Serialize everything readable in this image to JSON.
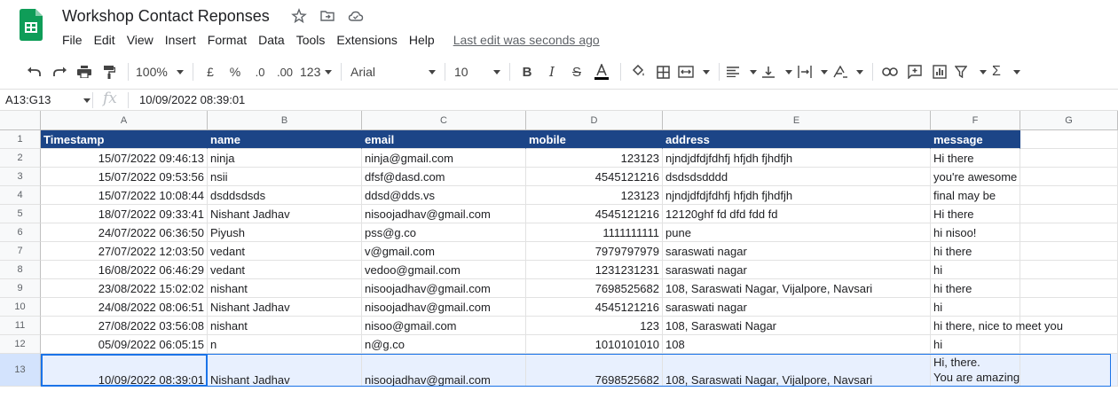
{
  "app": {
    "title": "Workshop Contact Reponses",
    "menus": [
      "File",
      "Edit",
      "View",
      "Insert",
      "Format",
      "Data",
      "Tools",
      "Extensions",
      "Help"
    ],
    "last_edit": "Last edit was seconds ago"
  },
  "toolbar": {
    "zoom": "100%",
    "currency": "£",
    "percent": "%",
    "dec_decrease": ".0",
    "dec_increase": ".00",
    "more_formats": "123",
    "font": "Arial",
    "font_size": "10"
  },
  "formula_bar": {
    "name_box": "A13:G13",
    "fx": "fx",
    "value": "10/09/2022 08:39:01"
  },
  "columns": [
    "A",
    "B",
    "C",
    "D",
    "E",
    "F",
    "G"
  ],
  "header_row": [
    "Timestamp",
    "name",
    "email",
    "mobile",
    "address",
    "message",
    ""
  ],
  "rows": [
    [
      "15/07/2022 09:46:13",
      "ninja",
      "ninja@gmail.com",
      "123123",
      "njndjdfdjfdhfj hfjdh fjhdfjh",
      "Hi there"
    ],
    [
      "15/07/2022 09:53:56",
      "nsii",
      "dfsf@dasd.com",
      "4545121216",
      "dsdsdsdddd",
      "you're awesome"
    ],
    [
      "15/07/2022 10:08:44",
      "dsddsdsds",
      "ddsd@dds.vs",
      "123123",
      "njndjdfdjfdhfj hfjdh fjhdfjh",
      "final may be"
    ],
    [
      "18/07/2022 09:33:41",
      "Nishant Jadhav",
      "nisoojadhav@gmail.com",
      "4545121216",
      "12120ghf fd dfd fdd fd",
      "Hi there"
    ],
    [
      "24/07/2022 06:36:50",
      "Piyush",
      "pss@g.co",
      "1111111111",
      "pune",
      "hi nisoo!"
    ],
    [
      "27/07/2022 12:03:50",
      "vedant",
      "v@gmail.com",
      "7979797979",
      "saraswati nagar",
      "hi there"
    ],
    [
      "16/08/2022 06:46:29",
      "vedant",
      "vedoo@gmail.com",
      "1231231231",
      "saraswati nagar",
      "hi"
    ],
    [
      "23/08/2022 15:02:02",
      "nishant",
      "nisoojadhav@gmail.com",
      "7698525682",
      "108, Saraswati Nagar, Vijalpore, Navsari",
      "hi there"
    ],
    [
      "24/08/2022 08:06:51",
      "Nishant Jadhav",
      "nisoojadhav@gmail.com",
      "4545121216",
      "saraswati nagar",
      "hi"
    ],
    [
      "27/08/2022 03:56:08",
      "nishant",
      "nisoo@gmail.com",
      "123",
      "108, Saraswati Nagar",
      "hi there, nice to meet you"
    ],
    [
      "05/09/2022 06:05:15",
      "n",
      "n@g.co",
      "1010101010",
      "108",
      "hi"
    ],
    [
      "10/09/2022 08:39:01",
      "Nishant Jadhav",
      "nisoojadhav@gmail.com",
      "7698525682",
      "108, Saraswati Nagar, Vijalpore, Navsari",
      "Hi, there.\nYou are amazing!"
    ]
  ],
  "row_numbers": [
    "1",
    "2",
    "3",
    "4",
    "5",
    "6",
    "7",
    "8",
    "9",
    "10",
    "11",
    "12",
    "13"
  ],
  "selected_row": 13,
  "colors": {
    "header_fill": "#1c4587",
    "header_text": "#ffffff",
    "selection": "#1a73e8",
    "selection_fill": "#e8f0fe"
  }
}
